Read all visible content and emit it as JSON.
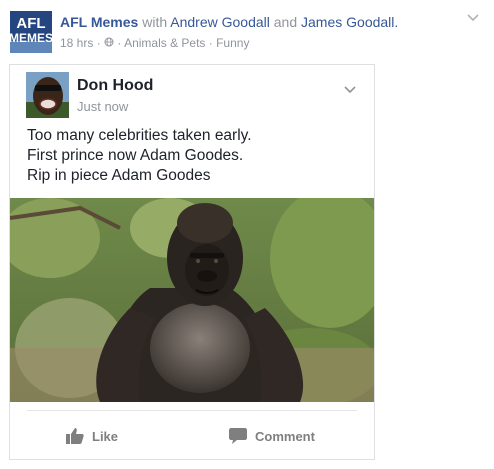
{
  "outer_post": {
    "page_name": "AFL Memes",
    "with_text": "with",
    "tagged_1": "Andrew Goodall",
    "and_text": "and",
    "tagged_2": "James Goodall.",
    "timestamp": "18 hrs",
    "separator": "·",
    "category": "Animals & Pets · Funny",
    "avatar_text_top": "AFL",
    "avatar_text_bottom": "MEMES"
  },
  "shared_post": {
    "author": "Don Hood",
    "time": "Just now",
    "lines": [
      "Too many celebrities taken early.",
      "First prince now Adam Goodes.",
      "Rip in piece Adam Goodes"
    ]
  },
  "actions": {
    "like_label": "Like",
    "comment_label": "Comment"
  },
  "colors": {
    "link": "#365899",
    "meta": "#90949c",
    "text": "#1d2129",
    "border": "#dddfe2"
  },
  "icons": {
    "globe": "globe-icon",
    "chevron": "chevron-down-icon",
    "like": "thumbs-up-icon",
    "comment": "comment-bubble-icon"
  }
}
